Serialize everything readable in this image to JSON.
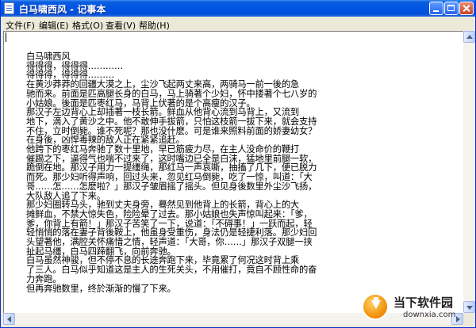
{
  "window": {
    "title": "白马啸西风 - 记事本"
  },
  "menu": {
    "items": [
      "文件(F)",
      "编辑(E)",
      "格式(O)",
      "查看(V)",
      "帮助(H)"
    ]
  },
  "editor": {
    "text": "白马啸西风\n得得得，得得得…………\n得得得，得得得………\n在黄沙莽莽的回疆大漠之上，尘沙飞起两丈来高，两骑马一前一後的急\n驰而来。前面是匹高腿长身的白马，马上骑著个少妇，怀中搂著个七八岁的\n小姑娘。後面是匹枣红马，马背上伏著的是个高瘦的汉子。\n那汉子左边背心上却插著一枝长箭。鲜血从他背心流到马背上，又流到\n地下，滴入了黄沙之中。他不敢伸手拔箭，只怕这枝箭一拔下来，就会支持\n不住，立时倒毙。谁不死呢？那也没什麽。可是谁来照料前面的娇妻幼女？\n在身後，凶悍毒辣的敌人正在紧紧追赶。\n他跨下的枣红马奔驰了数十里地，早已筋疲力尽，在主人没命价的鞭打\n催踢之下，逼得气也喘不过来了，这时嘴边已全是白沫，猛地里前腿一软，\n跪倒在地。那汉子用力一提缰绳，那红马一声哀嘶，抽搐了几下，便已脱力\n而死。那少妇听得声响，回过头来，忽见红马倒毙，吃了一惊，叫道：「大\n哥……怎……怎麽啦？」那汉子皱眉摇了摇头。但见身後数里外尘沙飞扬，\n大队敌人追了下来。\n那少妇圈转马头，驰到丈夫身旁，蓦然见到他背上的长箭，背心上的大\n摊鲜血，不禁大惊失色，险险晕了过去。那小姑娘也失声惊叫起来：「爹，\n爹，你背上有箭！」那汉子苦笑了一下，说道：「不碍事！」一跃而起，轻\n轻悄悄的落在妻子背後鞍上，他虽身受重伤，身法仍是轻捷利落。那少妇回\n头望著他，满腔关怀痛惜之情，轻声道：「大哥，你……」那汉子双腿一挟\n扯起马缰，白马四蹄翻飞，向前奔驰。\n白马虽然神骏，但不停不息的长途奔跑下来，毕竟累了何况这时背上乘\n了三人。白马似乎知道这是主人的生死关头，不用催打，竟自不顾性命的奋\n力奔跑。\n但再奔驰数里，终於渐渐的慢了下来。"
  },
  "watermark": {
    "name": "当下软件园",
    "url": "downxia.com"
  },
  "colors": {
    "titlebar": "#0055e5",
    "close_button": "#c9442a",
    "window_frame": "#ece9d8"
  }
}
